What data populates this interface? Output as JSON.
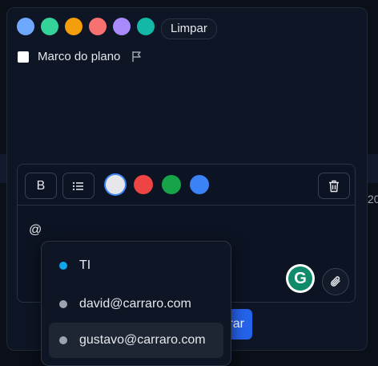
{
  "color_picker": {
    "colors": [
      "#6ea8ff",
      "#34d399",
      "#f59e0b",
      "#f87171",
      "#a78bfa",
      "#14b8a6"
    ],
    "clear_label": "Limpar"
  },
  "milestone": {
    "label": "Marco do plano",
    "checked": false
  },
  "editor": {
    "toolbar": {
      "bold_label": "B",
      "text_colors": [
        "#e5e7eb",
        "#ef4444",
        "#16a34a",
        "#3b82f6"
      ],
      "selected_color": "#e5e7eb"
    },
    "content": "@",
    "grammarly_label": "G"
  },
  "save_button_label": "rar",
  "background_year_partial": "20",
  "mention_suggestions": {
    "items": [
      {
        "label": "TI",
        "dot_color": "#0ea5e9"
      },
      {
        "label": "david@carraro.com",
        "dot_color": "#9ca3af"
      },
      {
        "label": "gustavo@carraro.com",
        "dot_color": "#9ca3af",
        "highlighted": true
      }
    ]
  }
}
